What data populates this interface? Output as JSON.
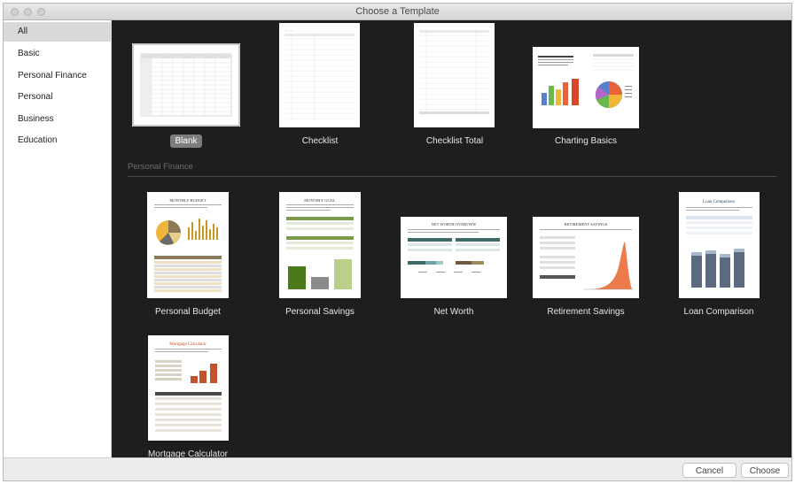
{
  "window": {
    "title": "Choose a Template"
  },
  "sidebar": {
    "items": [
      {
        "label": "All"
      },
      {
        "label": "Basic"
      },
      {
        "label": "Personal Finance"
      },
      {
        "label": "Personal"
      },
      {
        "label": "Business"
      },
      {
        "label": "Education"
      }
    ]
  },
  "gallery": {
    "section_personal_finance": "Personal Finance",
    "templates": [
      {
        "name": "Blank"
      },
      {
        "name": "Checklist"
      },
      {
        "name": "Checklist Total"
      },
      {
        "name": "Charting Basics"
      },
      {
        "name": "Personal Budget",
        "heading": "MONTHLY BUDGET"
      },
      {
        "name": "Personal Savings",
        "heading": "MONTHLY GOAL"
      },
      {
        "name": "Net Worth",
        "heading": "NET WORTH OVERVIEW"
      },
      {
        "name": "Retirement Savings",
        "heading": "RETIREMENT SAVINGS"
      },
      {
        "name": "Loan Comparison",
        "heading": "Loan Comparison"
      },
      {
        "name": "Mortgage Calculator",
        "heading": "Mortgage Calculator"
      }
    ]
  },
  "footer": {
    "cancel_label": "Cancel",
    "choose_label": "Choose"
  }
}
